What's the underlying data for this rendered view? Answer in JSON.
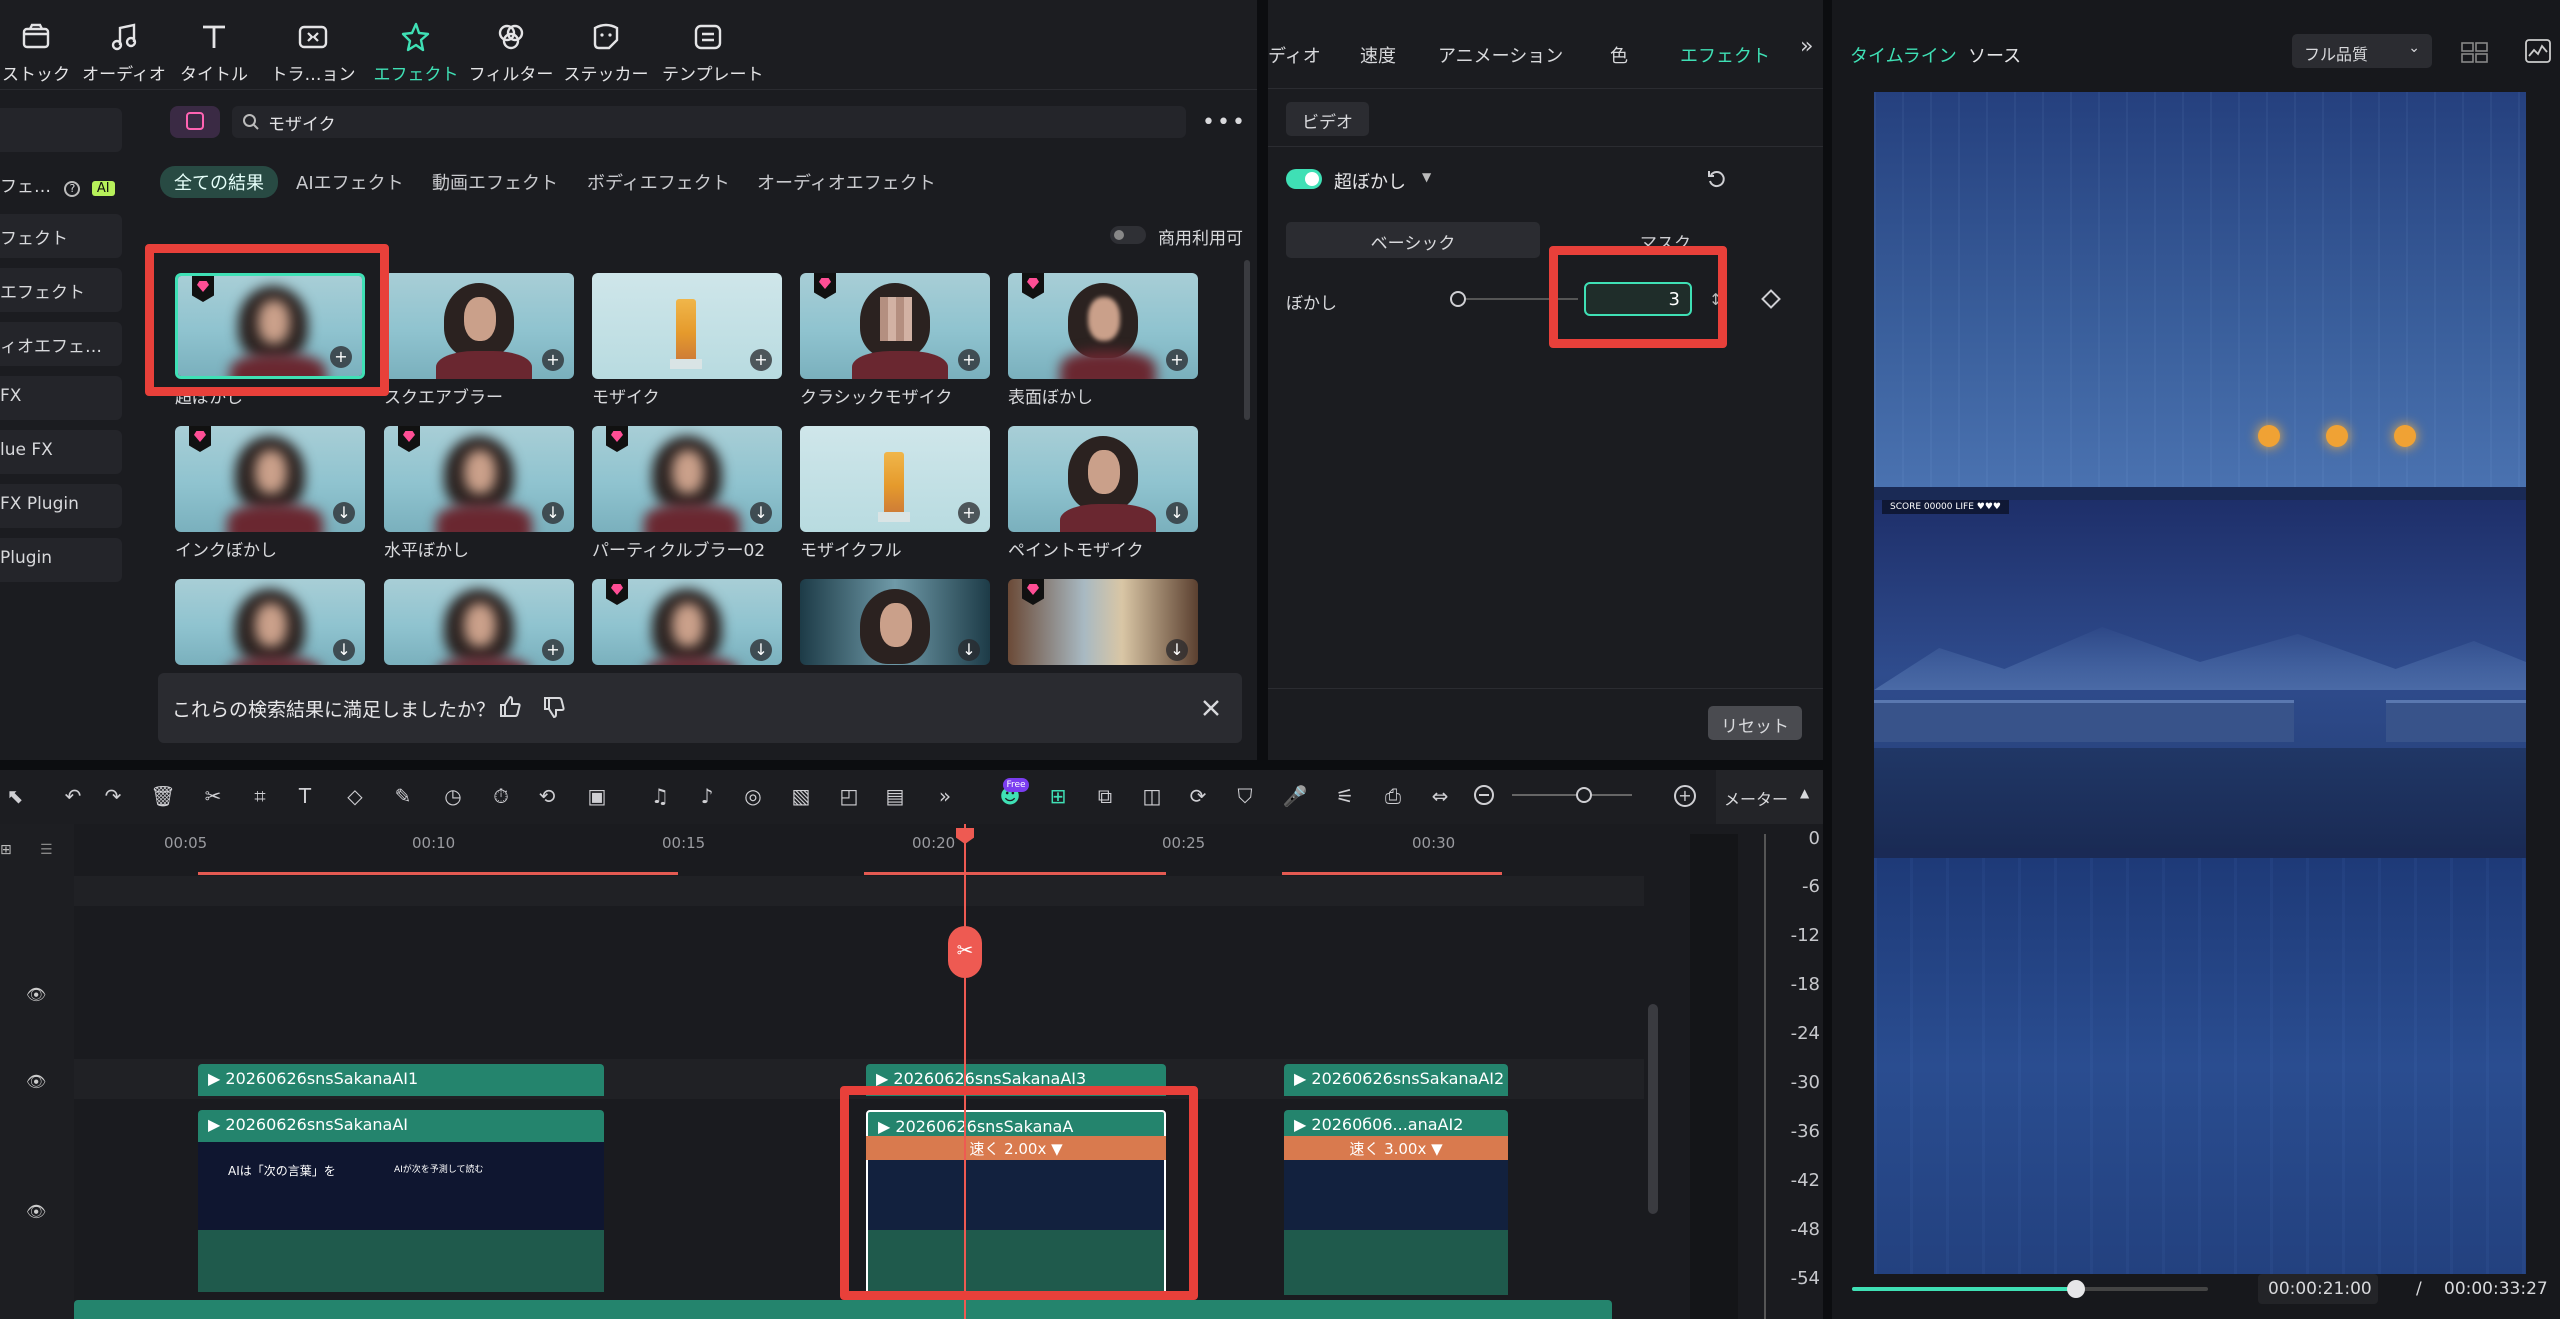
{
  "toolbar": {
    "items": [
      {
        "label": "ストック",
        "icon": "stock-icon"
      },
      {
        "label": "オーディオ",
        "icon": "music-note-icon"
      },
      {
        "label": "タイトル",
        "icon": "text-t-icon"
      },
      {
        "label": "トラ…ョン",
        "icon": "transition-icon"
      },
      {
        "label": "エフェクト",
        "icon": "effects-star-icon"
      },
      {
        "label": "フィルター",
        "icon": "filter-icon"
      },
      {
        "label": "ステッカー",
        "icon": "sticker-icon"
      },
      {
        "label": "テンプレート",
        "icon": "template-icon"
      }
    ]
  },
  "left_nav": {
    "items": [
      "フェ…",
      "フェクト",
      "エフェクト",
      "ィオエフェ…",
      "FX",
      "lue FX",
      "FX Plugin",
      "Plugin"
    ],
    "ai_badge": "AI"
  },
  "effects": {
    "search_value": "モザイク",
    "filter_tabs": [
      "全ての結果",
      "AIエフェクト",
      "動画エフェクト",
      "ボディエフェクト",
      "オーディオエフェクト"
    ],
    "commercial_label": "商用利用可",
    "items": [
      {
        "label": "超ぼかし",
        "style": "blur",
        "premium": true
      },
      {
        "label": "スクエアブラー",
        "style": "portrait",
        "premium": false
      },
      {
        "label": "モザイク",
        "style": "lighthouse",
        "premium": false
      },
      {
        "label": "クラシックモザイク",
        "style": "mosaic",
        "premium": true
      },
      {
        "label": "表面ぼかし",
        "style": "blur",
        "premium": true
      },
      {
        "label": "インクぼかし",
        "style": "motion",
        "premium": true
      },
      {
        "label": "水平ぼかし",
        "style": "motion",
        "premium": true
      },
      {
        "label": "パーティクルブラー02",
        "style": "motion",
        "premium": true
      },
      {
        "label": "モザイクフル",
        "style": "lighthouse",
        "premium": false
      },
      {
        "label": "ペイントモザイク",
        "style": "portrait",
        "premium": false
      }
    ],
    "feedback_question": "これらの検索結果に満足しましたか？"
  },
  "properties": {
    "tabs": [
      "ディオ",
      "速度",
      "アニメーション",
      "色",
      "エフェクト"
    ],
    "section_tab": "ビデオ",
    "effect_name": "超ぼかし",
    "subtabs": [
      "ベーシック",
      "マスク"
    ],
    "blur_label": "ぼかし",
    "blur_value": "3",
    "reset_label": "リセット"
  },
  "preview": {
    "tabs": [
      "タイムライン",
      "ソース"
    ],
    "quality": "フル品質",
    "current_time": "00:00:21:00",
    "separator": "/",
    "total_time": "00:00:33:27",
    "progress": 0.63,
    "score_text": "SCORE 00000   LIFE ♥♥♥"
  },
  "timeline": {
    "meter_label": "メーター",
    "ruler": [
      "00:05",
      "00:10",
      "00:15",
      "00:20",
      "00:25",
      "00:30"
    ],
    "clips_top": [
      "20260626snsSakanaAI1",
      "20260626snsSakanaAI3",
      "20260626snsSakanaAI2"
    ],
    "clips_main": [
      "20260626snsSakanaAI",
      "20260626snsSakanaA",
      "20260б06...anaAI2"
    ],
    "speeds": [
      "速く 2.00x",
      "速く 3.00x"
    ],
    "clip_caption_a": "AIは「次の言葉」を",
    "clip_caption_b": "AIが次を予測して読む",
    "meter": [
      "0",
      "-6",
      "-12",
      "-18",
      "-24",
      "-30",
      "-36",
      "-42",
      "-48",
      "-54"
    ],
    "free_badge": "Free"
  },
  "colors": {
    "accent": "#3fe0b5",
    "highlight_box": "#e8403a",
    "clip_green": "#24846d",
    "speed_orange": "#d97a4e",
    "playhead": "#ee5a52"
  }
}
